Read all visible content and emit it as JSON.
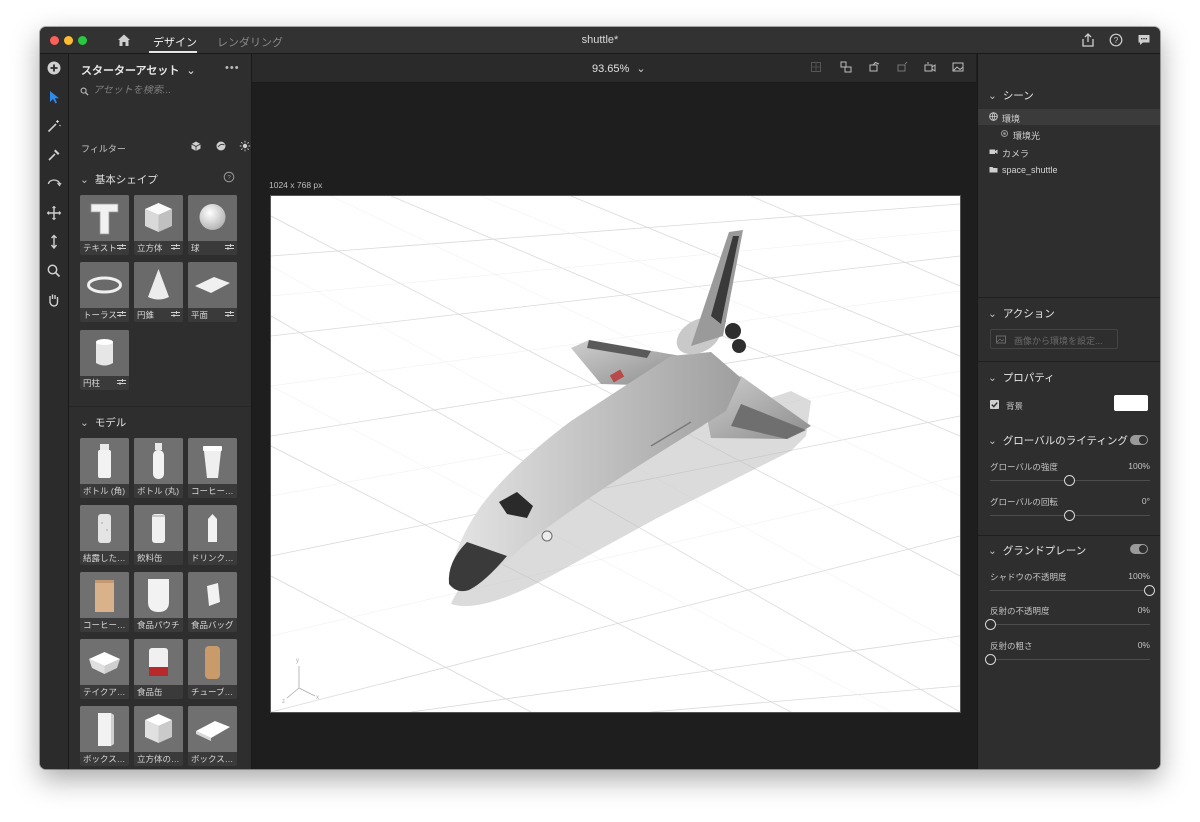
{
  "titlebar": {
    "tabs": [
      {
        "label": "デザイン",
        "active": true
      },
      {
        "label": "レンダリング",
        "active": false
      }
    ],
    "document_title": "shuttle*"
  },
  "left_panel": {
    "title": "スターターアセット",
    "more": "•••",
    "search_placeholder": "アセットを検索...",
    "filter_label": "フィルター",
    "sections": {
      "basic_shapes": "基本シェイプ",
      "models": "モデル"
    },
    "basic_shapes": [
      {
        "label": "テキスト",
        "icon": "text-shape"
      },
      {
        "label": "立方体",
        "icon": "cube-shape"
      },
      {
        "label": "球",
        "icon": "sphere-shape"
      },
      {
        "label": "トーラス",
        "icon": "torus-shape"
      },
      {
        "label": "円錐",
        "icon": "cone-shape"
      },
      {
        "label": "平面",
        "icon": "plane-shape"
      },
      {
        "label": "円柱",
        "icon": "cylinder-shape"
      }
    ],
    "models": [
      {
        "label": "ボトル (角)"
      },
      {
        "label": "ボトル (丸)"
      },
      {
        "label": "コーヒー…"
      },
      {
        "label": "結露した…"
      },
      {
        "label": "飲料缶"
      },
      {
        "label": "ドリンク…"
      },
      {
        "label": "コーヒー…"
      },
      {
        "label": "食品パウチ"
      },
      {
        "label": "食品バッグ"
      },
      {
        "label": "テイクア…"
      },
      {
        "label": "食品缶"
      },
      {
        "label": "チューブ…"
      },
      {
        "label": "ボックス…"
      },
      {
        "label": "立方体の…"
      },
      {
        "label": "ボックス…"
      }
    ]
  },
  "canvas": {
    "zoom": "93.65%",
    "dimensions": "1024 x 768 px",
    "background_color": "#ffffff"
  },
  "right_panel": {
    "scene": {
      "title": "シーン",
      "items": [
        {
          "label": "環境",
          "icon": "environment-icon",
          "selected": true
        },
        {
          "label": "環境光",
          "icon": "light-icon",
          "selected": false
        },
        {
          "label": "カメラ",
          "icon": "camera-icon",
          "selected": false
        },
        {
          "label": "space_shuttle",
          "icon": "folder-icon",
          "selected": false
        }
      ]
    },
    "actions": {
      "title": "アクション",
      "button": "画像から環境を設定..."
    },
    "properties": {
      "title": "プロパティ",
      "background_label": "背景",
      "background_checked": true,
      "background_color": "#ffffff"
    },
    "global_lighting": {
      "title": "グローバルのライティング",
      "enabled": true,
      "intensity_label": "グローバルの強度",
      "intensity_value": "100%",
      "intensity_level": 0.5,
      "rotation_label": "グローバルの回転",
      "rotation_value": "0°",
      "rotation_level": 0.5
    },
    "ground_plane": {
      "title": "グランドプレーン",
      "enabled": true,
      "shadow_label": "シャドウの不透明度",
      "shadow_value": "100%",
      "shadow_level": 1.0,
      "reflection_opacity_label": "反射の不透明度",
      "reflection_opacity_value": "0%",
      "reflection_opacity_level": 0.0,
      "reflection_roughness_label": "反射の粗さ",
      "reflection_roughness_value": "0%",
      "reflection_roughness_level": 0.0
    }
  }
}
